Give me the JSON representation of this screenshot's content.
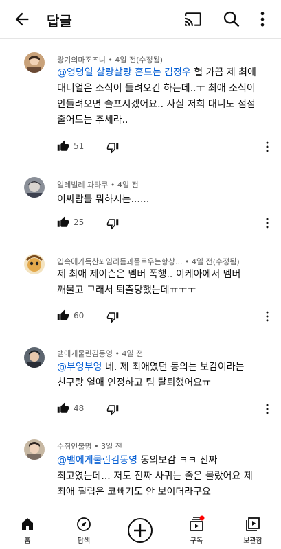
{
  "header": {
    "title": "답글",
    "back_icon": "back-arrow-icon",
    "cast_icon": "cast-icon",
    "search_icon": "search-icon",
    "menu_icon": "more-vert-icon"
  },
  "accent": {
    "link": "#065fd4",
    "notification": "#ff0000"
  },
  "comments": [
    {
      "author": "광기의마조즈니",
      "time": "4일 전(수정됨)",
      "mention": "@엉덩일 살랑살랑 흔드는 김정우",
      "text_line1": " 헐 가끔 제 최애",
      "lines": [
        "대니얼은 소식이 들려오긴 하는데..ㅜ 최애 소식이",
        "안들려오면 슬프시겠어요.. 사실 저희 대니도 점점",
        "줄어드는 추세라.."
      ],
      "likes": "51"
    },
    {
      "author": "얼레벌레 과타쿠",
      "time": "4일 전",
      "lines": [
        "이싸람들 뭐하시는......"
      ],
      "likes": "25"
    },
    {
      "author": "입속에가득찬퐈임리듬과플로우는항상...",
      "time": "4일 전(수정됨)",
      "lines": [
        "제 최애 제이슨은 멤버 폭행.. 이케아에서 멤버",
        "깨물고 그래서 퇴출당했는데ㅠㅜㅜ"
      ],
      "likes": "60"
    },
    {
      "author": "뱀에게물린김동영",
      "time": "4일 전",
      "mention": "@부엉부엉",
      "text_line1": " 네. 제 최애였던 동의는 보감이라는",
      "lines": [
        "친구랑 열애 인정하고 팀 탈퇴했어요ㅠ"
      ],
      "likes": "48"
    },
    {
      "author": "수취인불명",
      "time": "3일 전",
      "mention": "@뱀에게물린김동영",
      "text_line1": " 동의보감 ㅋㅋ 진짜",
      "lines": [
        "최고였는데... 저도 진짜 사귀는 줄은 몰랐어요 제",
        "최애 필립은 코빼기도 안 보이더라구요"
      ]
    }
  ],
  "nav": [
    {
      "label": "홈",
      "icon": "home-icon"
    },
    {
      "label": "탐색",
      "icon": "explore-compass-icon"
    },
    {
      "label": "",
      "icon": "add-icon"
    },
    {
      "label": "구독",
      "icon": "subscriptions-icon"
    },
    {
      "label": "보관함",
      "icon": "library-icon"
    }
  ]
}
